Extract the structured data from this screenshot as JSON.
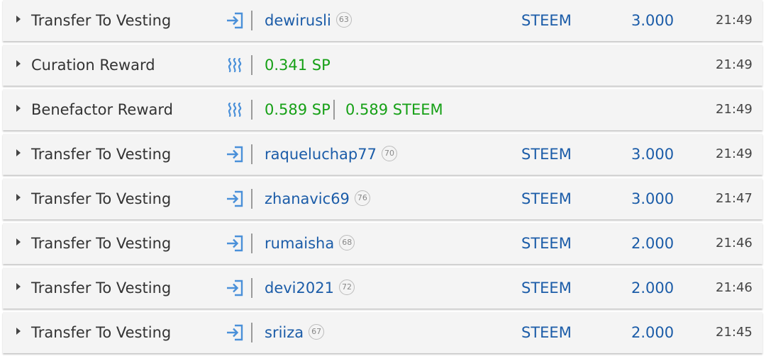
{
  "rows": [
    {
      "type": "Transfer To Vesting",
      "icon": "transfer-in-icon",
      "user": "dewirusli",
      "rep": "63",
      "currency": "STEEM",
      "amount": "3.000",
      "time": "21:49"
    },
    {
      "type": "Curation Reward",
      "icon": "steem-logo-icon",
      "reward": "0.341 SP",
      "time": "21:49"
    },
    {
      "type": "Benefactor Reward",
      "icon": "steem-logo-icon",
      "reward": "0.589 SP",
      "reward2": "0.589 STEEM",
      "time": "21:49"
    },
    {
      "type": "Transfer To Vesting",
      "icon": "transfer-in-icon",
      "user": "raqueluchap77",
      "rep": "70",
      "currency": "STEEM",
      "amount": "3.000",
      "time": "21:49"
    },
    {
      "type": "Transfer To Vesting",
      "icon": "transfer-in-icon",
      "user": "zhanavic69",
      "rep": "76",
      "currency": "STEEM",
      "amount": "3.000",
      "time": "21:47"
    },
    {
      "type": "Transfer To Vesting",
      "icon": "transfer-in-icon",
      "user": "rumaisha",
      "rep": "68",
      "currency": "STEEM",
      "amount": "2.000",
      "time": "21:46"
    },
    {
      "type": "Transfer To Vesting",
      "icon": "transfer-in-icon",
      "user": "devi2021",
      "rep": "72",
      "currency": "STEEM",
      "amount": "2.000",
      "time": "21:46"
    },
    {
      "type": "Transfer To Vesting",
      "icon": "transfer-in-icon",
      "user": "sriiza",
      "rep": "67",
      "currency": "STEEM",
      "amount": "2.000",
      "time": "21:45"
    }
  ],
  "colors": {
    "link": "#1b5ca8",
    "reward": "#16a016",
    "icon": "#4a90d9",
    "text": "#333333"
  }
}
